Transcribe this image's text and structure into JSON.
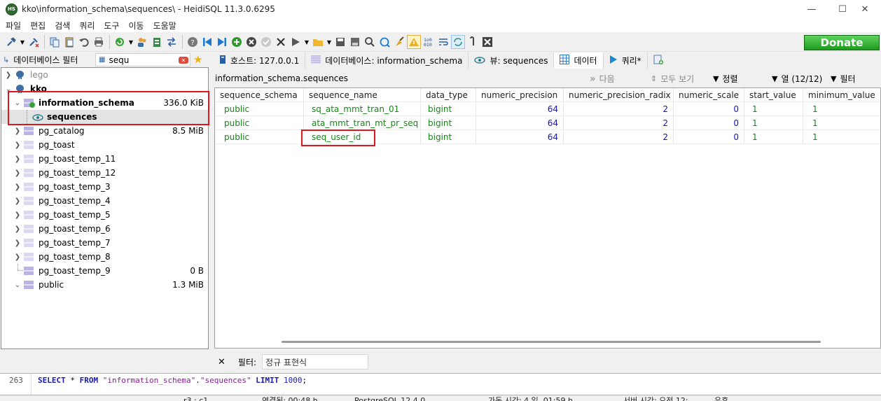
{
  "window": {
    "title": "kko\\information_schema\\sequences\\ - HeidiSQL 11.3.0.6295",
    "app_icon": "HS",
    "minimize": "—",
    "maximize": "☐",
    "close": "✕"
  },
  "menu": [
    "파일",
    "편집",
    "검색",
    "쿼리",
    "도구",
    "이동",
    "도움말"
  ],
  "toolbar": {
    "donate_label": "Donate",
    "icons": [
      "connect-icon",
      "dropdown-icon",
      "disconnect-icon",
      "copy-icon",
      "paste-icon",
      "undo-icon",
      "print-icon",
      "refresh-icon",
      "dropdown-icon",
      "user-manager-icon",
      "export-icon",
      "transfer-icon",
      "help-icon",
      "first-icon",
      "last-icon",
      "insert-row-icon",
      "cancel-row-icon",
      "post-row-icon",
      "delete-icon",
      "run-icon",
      "dropdown-icon",
      "open-file-icon",
      "dropdown-icon",
      "save-icon",
      "save-snippet-icon",
      "find-icon",
      "replace-icon",
      "clear-icon",
      "warning-icon",
      "binary-icon",
      "wordwrap-icon",
      "sync-icon",
      "stop-icon",
      "close-icon"
    ]
  },
  "left_filter": {
    "label": "데이터베이스 필터",
    "value": "sequ",
    "table_filter_icon": "table-filter-icon"
  },
  "tree": {
    "items": [
      {
        "label": "lego",
        "size": "",
        "level": 0,
        "bold": false,
        "type": "server"
      },
      {
        "label": "kko",
        "size": "",
        "level": 0,
        "bold": true,
        "type": "server"
      },
      {
        "label": "information_schema",
        "size": "336.0 KiB",
        "level": 1,
        "bold": true,
        "type": "database"
      },
      {
        "label": "sequences",
        "size": "",
        "level": 2,
        "bold": true,
        "type": "view",
        "selected": true
      },
      {
        "label": "pg_catalog",
        "size": "8.5 MiB",
        "level": 1,
        "bold": false,
        "type": "database"
      },
      {
        "label": "pg_toast",
        "size": "",
        "level": 1,
        "bold": false,
        "type": "database"
      },
      {
        "label": "pg_toast_temp_11",
        "size": "",
        "level": 1,
        "bold": false,
        "type": "database"
      },
      {
        "label": "pg_toast_temp_12",
        "size": "",
        "level": 1,
        "bold": false,
        "type": "database"
      },
      {
        "label": "pg_toast_temp_3",
        "size": "",
        "level": 1,
        "bold": false,
        "type": "database"
      },
      {
        "label": "pg_toast_temp_4",
        "size": "",
        "level": 1,
        "bold": false,
        "type": "database"
      },
      {
        "label": "pg_toast_temp_5",
        "size": "",
        "level": 1,
        "bold": false,
        "type": "database"
      },
      {
        "label": "pg_toast_temp_6",
        "size": "",
        "level": 1,
        "bold": false,
        "type": "database"
      },
      {
        "label": "pg_toast_temp_7",
        "size": "",
        "level": 1,
        "bold": false,
        "type": "database"
      },
      {
        "label": "pg_toast_temp_8",
        "size": "",
        "level": 1,
        "bold": false,
        "type": "database"
      },
      {
        "label": "pg_toast_temp_9",
        "size": "0 B",
        "level": 1,
        "bold": false,
        "type": "database"
      },
      {
        "label": "public",
        "size": "1.3 MiB",
        "level": 1,
        "bold": false,
        "type": "database"
      }
    ]
  },
  "tabs": [
    {
      "label": "호스트: 127.0.0.1",
      "icon": "host-icon"
    },
    {
      "label": "데이터베이스: information_schema",
      "icon": "database-icon"
    },
    {
      "label": "뷰: sequences",
      "icon": "view-icon"
    },
    {
      "label": "데이터",
      "icon": "grid-icon",
      "active": true
    },
    {
      "label": "쿼리*",
      "icon": "play-icon"
    },
    {
      "label": "",
      "icon": "new-query-icon"
    }
  ],
  "data_header": {
    "table_name": "information_schema.sequences",
    "next": "다음",
    "show_all": "모두 보기",
    "sort": "정렬",
    "columns": "열 (12/12)",
    "filter": "필터"
  },
  "grid": {
    "columns": [
      "sequence_schema",
      "sequence_name",
      "data_type",
      "numeric_precision",
      "numeric_precision_radix",
      "numeric_scale",
      "start_value",
      "minimum_value"
    ],
    "rows": [
      [
        "public",
        "sq_ata_mmt_tran_01",
        "bigint",
        "64",
        "2",
        "0",
        "1",
        "1"
      ],
      [
        "public",
        "ata_mmt_tran_mt_pr_seq",
        "bigint",
        "64",
        "2",
        "0",
        "1",
        "1"
      ],
      [
        "public",
        "seq_user_id",
        "bigint",
        "64",
        "2",
        "0",
        "1",
        "1"
      ]
    ]
  },
  "filter_bar": {
    "close": "✕",
    "label": "필터:",
    "placeholder": "정규 표현식"
  },
  "sql": {
    "line": "263",
    "kw1": "SELECT",
    "star": " * ",
    "kw2": "FROM",
    "schema": "\"information_schema\"",
    "dot": ".",
    "table": "\"sequences\"",
    "kw3": " LIMIT ",
    "limit": "1000",
    "end": ";"
  },
  "status": {
    "position": "r3 : c1",
    "connected": "연결됨: 00:48 h",
    "server": "PostgreSQL 12.4.0",
    "uptime": "가동 시간: 4 일, 01:59 h",
    "server_time": "서버 시간: 오전 12:",
    "idle": "유휴"
  },
  "colors": {
    "highlight_red": "#e0161c",
    "text_value_green": "#118a11",
    "number_blue": "#1414c8",
    "donate_green": "#2fb32f",
    "selection_bg": "#e3e3e3"
  }
}
